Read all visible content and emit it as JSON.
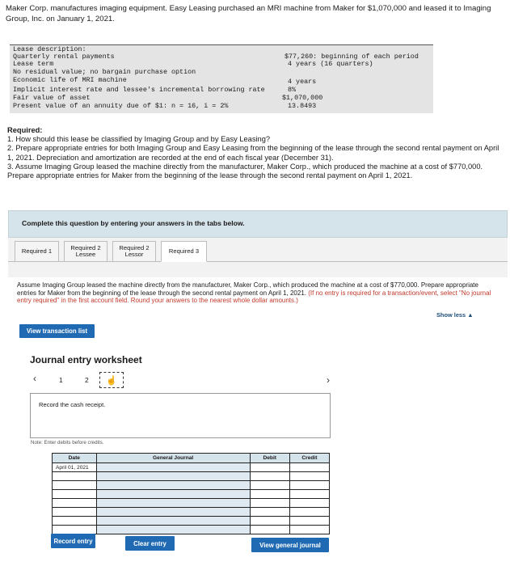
{
  "intro": "Maker Corp. manufactures imaging equipment. Easy Leasing purchased an MRI machine from Maker for $1,070,000 and leased it to Imaging Group, Inc. on January 1, 2021.",
  "lease": {
    "header": "Lease description:",
    "rows": [
      {
        "label": "Quarterly rental payments",
        "value": "$77,260: beginning of each period"
      },
      {
        "label": "Lease term",
        "value": "4 years (16 quarters)"
      },
      {
        "label": "No residual value; no bargain purchase option",
        "value": ""
      },
      {
        "label": "Economic life of MRI machine",
        "value": "4 years"
      },
      {
        "label": "Implicit interest rate and lessee's incremental borrowing rate",
        "value": "8%"
      },
      {
        "label": "Fair value of asset",
        "value": "$1,070,000"
      },
      {
        "label": "Present value of an annuity due of $1: n = 16, i = 2%",
        "value": "13.8493"
      }
    ]
  },
  "required": {
    "heading": "Required:",
    "items": [
      "1. How should this lease be classified by Imaging Group and by Easy Leasing?",
      "2. Prepare appropriate entries for both Imaging Group and Easy Leasing from the beginning of the lease through the second rental payment on April 1, 2021. Depreciation and amortization are recorded at the end of each fiscal year (December 31).",
      "3. Assume Imaging Group leased the machine directly from the manufacturer, Maker Corp., which produced the machine at a cost of $770,000. Prepare appropriate entries for Maker from the beginning of the lease through the second rental payment on April 1, 2021."
    ]
  },
  "complete_bar": "Complete this question by entering your answers in the tabs below.",
  "tabs": [
    {
      "label": "Required 1"
    },
    {
      "label": "Required 2 Lessee"
    },
    {
      "label": "Required 2 Lessor"
    },
    {
      "label": "Required 3"
    }
  ],
  "instruction": {
    "main": "Assume Imaging Group leased the machine directly from the manufacturer, Maker Corp., which produced the machine at a cost of $770,000. Prepare appropriate entries for Maker from the beginning of the lease through the second rental payment on April 1, 2021.",
    "red": "(If no entry is required for a transaction/event, select \"No journal entry required\" in the first account field. Round your answers to the nearest whole dollar amounts.)"
  },
  "show_less": "Show less ▲",
  "view_transaction_list": "View transaction list",
  "journal": {
    "title": "Journal entry worksheet",
    "pages": [
      "1",
      "2"
    ],
    "record_text": "Record the cash receipt.",
    "note": "Note: Enter debits before credits.",
    "columns": [
      "Date",
      "General Journal",
      "Debit",
      "Credit"
    ],
    "first_date": "April 01, 2021",
    "buttons": {
      "record": "Record entry",
      "clear": "Clear entry",
      "view_general": "View general journal"
    }
  }
}
